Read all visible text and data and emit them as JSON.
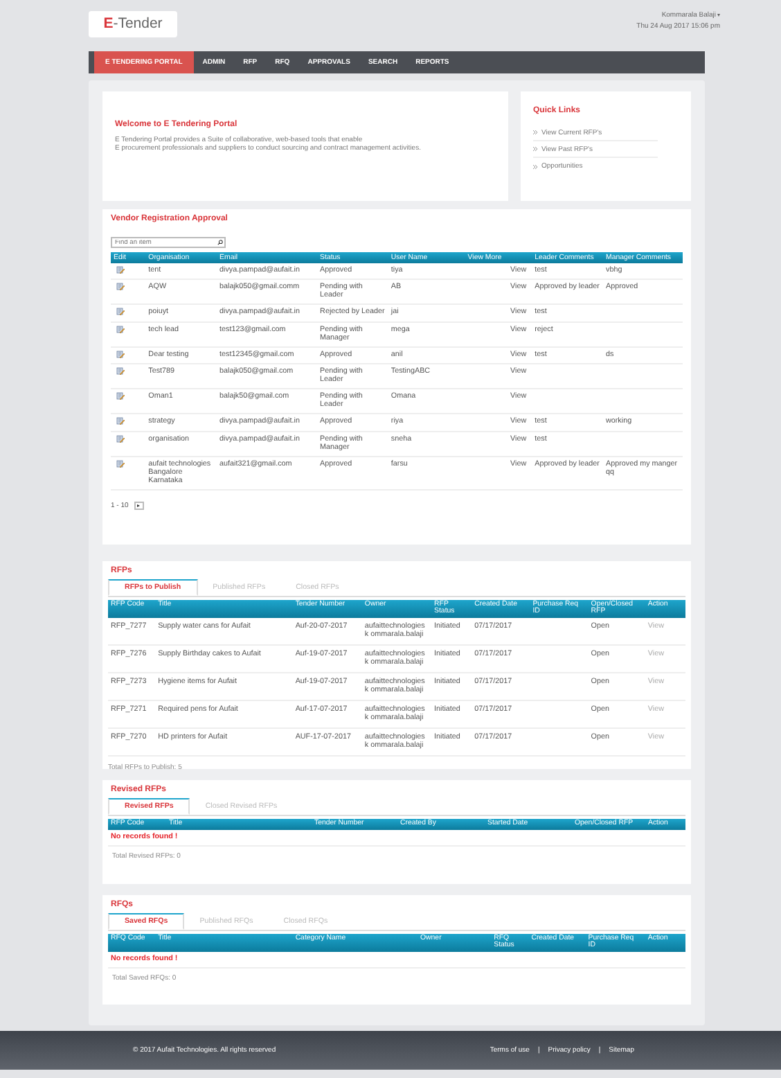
{
  "header": {
    "logo_mark": "E",
    "logo_text": "-Tender",
    "user": "Kommarala Balaji",
    "datetime": "Thu 24 Aug 2017 15:06 pm"
  },
  "nav": [
    {
      "label": "E TENDERING PORTAL",
      "selected": true
    },
    {
      "label": "ADMIN",
      "selected": false
    },
    {
      "label": "RFP",
      "selected": false
    },
    {
      "label": "RFQ",
      "selected": false
    },
    {
      "label": "APPROVALS",
      "selected": false
    },
    {
      "label": "SEARCH",
      "selected": false
    },
    {
      "label": "REPORTS",
      "selected": false
    }
  ],
  "welcome": {
    "title": "Welcome to E Tendering Portal",
    "text": "E Tendering Portal provides a Suite of collaborative, web-based tools that enable\nE procurement professionals and suppliers to conduct sourcing and contract management activities."
  },
  "quick_links": {
    "title": "Quick Links",
    "items": [
      "View Current RFP's",
      "View Past RFP's",
      "Opportunities"
    ]
  },
  "vendor_registration": {
    "title": "Vendor Registration Approval",
    "search": {
      "placeholder": "Find an item"
    },
    "columns": [
      "Edit",
      "Organisation",
      "Email",
      "Status",
      "User Name",
      "View More",
      "Leader Comments",
      "Manager Comments"
    ],
    "rows": [
      {
        "organisation": "tent",
        "email": "divya.pampad@aufait.in",
        "status": "Approved",
        "user_name": "tiya",
        "view_more": "View",
        "leader_comments": "test",
        "manager_comments": "vbhg"
      },
      {
        "organisation": "AQW",
        "email": "balajk050@gmail.comm",
        "status": "Pending with Leader",
        "user_name": "AB",
        "view_more": "View",
        "leader_comments": "Approved by leader",
        "manager_comments": "Approved"
      },
      {
        "organisation": "poiuyt",
        "email": "divya.pampad@aufait.in",
        "status": "Rejected by Leader",
        "user_name": "jai",
        "view_more": "View",
        "leader_comments": "test"
      },
      {
        "organisation": "tech lead",
        "email": "test123@gmail.com",
        "status": "Pending with Manager",
        "user_name": "mega",
        "view_more": "View",
        "leader_comments": "reject"
      },
      {
        "organisation": "Dear testing",
        "email": "test12345@gmail.com",
        "status": "Approved",
        "user_name": "anil",
        "view_more": "View",
        "leader_comments": "test",
        "manager_comments": "ds"
      },
      {
        "organisation": "Test789",
        "email": "balajk050@gmail.com",
        "status": "Pending with Leader",
        "user_name": "TestingABC",
        "view_more": "View"
      },
      {
        "organisation": "Oman1",
        "email": "balajk50@gmail.com",
        "status": "Pending with Leader",
        "user_name": "Omana",
        "view_more": "View"
      },
      {
        "organisation": "strategy",
        "email": "divya.pampad@aufait.in",
        "status": "Approved",
        "user_name": "riya",
        "view_more": "View",
        "leader_comments": "test",
        "manager_comments": "working"
      },
      {
        "organisation": "organisation",
        "email": "divya.pampad@aufait.in",
        "status": "Pending with Manager",
        "user_name": "sneha",
        "view_more": "View",
        "leader_comments": "test"
      },
      {
        "organisation": "aufait technologies Bangalore Karnataka",
        "email": "aufait321@gmail.com",
        "status": "Approved",
        "user_name": "farsu",
        "view_more": "View",
        "leader_comments": "Approved by leader",
        "manager_comments": "Approved my manger qq"
      }
    ],
    "pagination": "1 - 10"
  },
  "rfps": {
    "title": "RFPs",
    "tabs": [
      {
        "label": "RFPs to Publish",
        "selected": true
      },
      {
        "label": "Published RFPs",
        "selected": false
      },
      {
        "label": "Closed RFPs",
        "selected": false
      }
    ],
    "columns": [
      "RFP Code",
      "Title",
      "Tender Number",
      "Owner",
      "RFP Status",
      "Created Date",
      "Purchase Req ID",
      "Open/Closed RFP",
      "Action"
    ],
    "rows": [
      {
        "code": "RFP_7277",
        "title": "Supply water cans for Aufait",
        "tender_number": "Auf-20-07-2017",
        "owner": "aufaittechnologiesk ommarala.balaji",
        "status": "Initiated",
        "created_date": "07/17/2017",
        "open_closed": "Open",
        "action": "View"
      },
      {
        "code": "RFP_7276",
        "title": "Supply Birthday cakes to Aufait",
        "tender_number": "Auf-19-07-2017",
        "owner": "aufaittechnologiesk ommarala.balaji",
        "status": "Initiated",
        "created_date": "07/17/2017",
        "open_closed": "Open",
        "action": "View"
      },
      {
        "code": "RFP_7273",
        "title": "Hygiene items for Aufait",
        "tender_number": "Auf-19-07-2017",
        "owner": "aufaittechnologiesk ommarala.balaji",
        "status": "Initiated",
        "created_date": "07/17/2017",
        "open_closed": "Open",
        "action": "View"
      },
      {
        "code": "RFP_7271",
        "title": "Required pens for Aufait",
        "tender_number": "Auf-17-07-2017",
        "owner": "aufaittechnologiesk ommarala.balaji",
        "status": "Initiated",
        "created_date": "07/17/2017",
        "open_closed": "Open",
        "action": "View"
      },
      {
        "code": "RFP_7270",
        "title": "HD printers for Aufait",
        "tender_number": "AUF-17-07-2017",
        "owner": "aufaittechnologiesk ommarala.balaji",
        "status": "Initiated",
        "created_date": "07/17/2017",
        "open_closed": "Open",
        "action": "View"
      }
    ],
    "total": "Total RFPs to Publish: 5"
  },
  "revised_rfps": {
    "title": "Revised RFPs",
    "tabs": [
      {
        "label": "Revised RFPs",
        "selected": true
      },
      {
        "label": "Closed Revised RFPs",
        "selected": false
      }
    ],
    "columns": [
      "RFP Code",
      "Title",
      "Tender Number",
      "Created By",
      "Started Date",
      "Open/Closed RFP",
      "Action"
    ],
    "empty_message": "No records found !",
    "total": "Total Revised RFPs: 0"
  },
  "rfqs": {
    "title": "RFQs",
    "tabs": [
      {
        "label": "Saved RFQs",
        "selected": true
      },
      {
        "label": "Published RFQs",
        "selected": false
      },
      {
        "label": "Closed RFQs",
        "selected": false
      }
    ],
    "columns": [
      "RFQ Code",
      "Title",
      "Category Name",
      "Owner",
      "RFQ Status",
      "Created Date",
      "Purchase Req ID",
      "Action"
    ],
    "empty_message": "No records found !",
    "total": "Total Saved RFQs: 0"
  },
  "footer": {
    "copyright": "© 2017 Aufait Technologies. All rights reserved",
    "links": [
      "Terms of use",
      "Privacy policy",
      "Sitemap"
    ],
    "separators": [
      "|",
      "|"
    ]
  }
}
